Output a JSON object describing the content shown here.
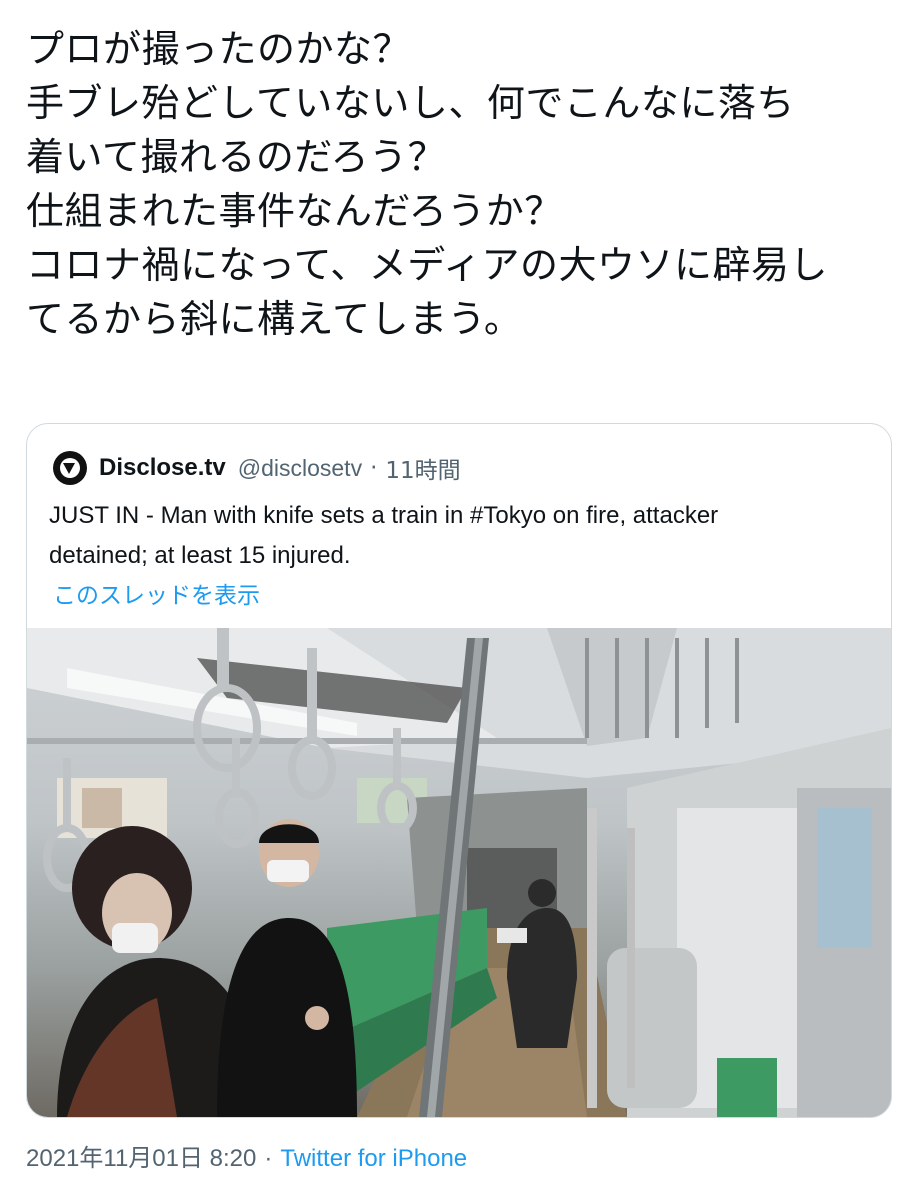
{
  "tweet": {
    "lines": [
      "プロが撮ったのかな？",
      "手ブレ殆どしていないし、何でこんなに落ち",
      "着いて撮れるのだろう？",
      "仕組まれた事件なんだろうか？",
      "コロナ禍になって、メディアの大ウソに辟易し",
      "てるから斜に構えてしまう。"
    ]
  },
  "quoted": {
    "avatar_icon": "disclose-logo-icon",
    "display_name": "Disclose.tv",
    "handle": "@disclosetv",
    "separator": "·",
    "time": "11時間",
    "body_line1": "JUST IN - Man with knife sets a train in #Tokyo on fire, attacker",
    "body_line2": "detained; at least 15 injured.",
    "show_thread": "このスレッドを表示",
    "media_description_icon": "train-interior-photo"
  },
  "meta": {
    "timestamp": "2021年11月01日 8:20",
    "separator": "·",
    "source": "Twitter for iPhone"
  },
  "colors": {
    "text": "#0f1419",
    "secondary": "#536471",
    "link": "#1d9bf0",
    "border": "#cfd9de",
    "seat_green": "#3e9a63"
  }
}
